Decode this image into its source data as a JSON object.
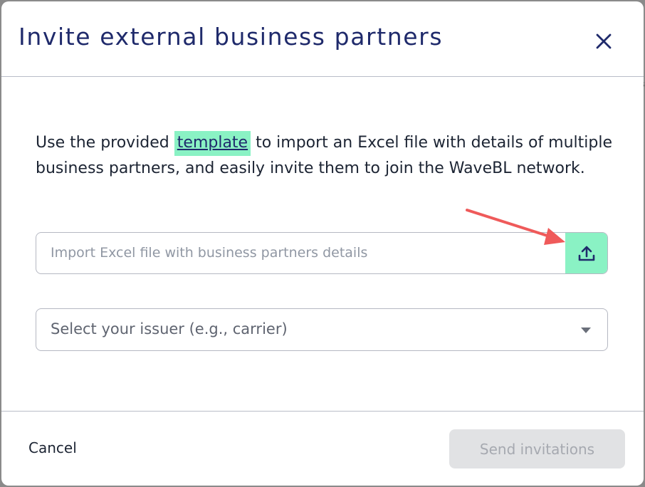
{
  "dialog": {
    "title": "Invite external business partners",
    "close_icon": "close-icon"
  },
  "description": {
    "before_link": "Use the provided ",
    "link_text": "template",
    "after_link": " to import an Excel file with details of multiple business partners, and easily invite them to join the WaveBL network."
  },
  "import_field": {
    "placeholder": "Import Excel file with business partners details",
    "upload_icon": "upload-icon"
  },
  "issuer_select": {
    "placeholder": "Select your issuer (e.g., carrier)",
    "chevron_icon": "chevron-down-icon"
  },
  "footer": {
    "cancel_label": "Cancel",
    "send_label": "Send invitations"
  },
  "colors": {
    "title": "#1f2a6b",
    "highlight": "#8af2c4",
    "annotation_arrow": "#ef5a5a",
    "disabled_button": "#e1e2e4"
  }
}
